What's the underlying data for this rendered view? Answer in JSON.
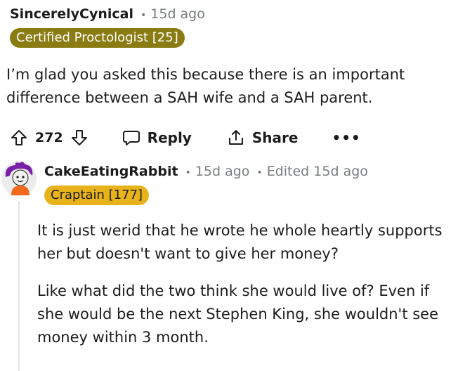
{
  "comment1": {
    "author": "SincerelyCynical",
    "separator": "•",
    "time": "15d ago",
    "flair": "Certified Proctologist [25]",
    "flair_color": "#8a7b12",
    "body": "I’m glad you asked this because there is an important difference between a SAH wife and a SAH parent."
  },
  "actions": {
    "upvote_icon": "arrow-up-icon",
    "vote_count": "272",
    "downvote_icon": "arrow-down-icon",
    "reply_label": "Reply",
    "share_label": "Share",
    "more_label": "•••"
  },
  "comment2": {
    "author": "CakeEatingRabbit",
    "separator": "•",
    "time": "15d ago",
    "edited": "Edited 15d ago",
    "flair": "Craptain [177]",
    "flair_color": "#e7b21a",
    "paragraphs": [
      "It is just werid that he wrote he whole heartly supports her but doesn't want to give her money?",
      "Like what did the two think she would live of? Even if she would be the next Stephen King, she wouldn't see money within 3 month."
    ]
  }
}
